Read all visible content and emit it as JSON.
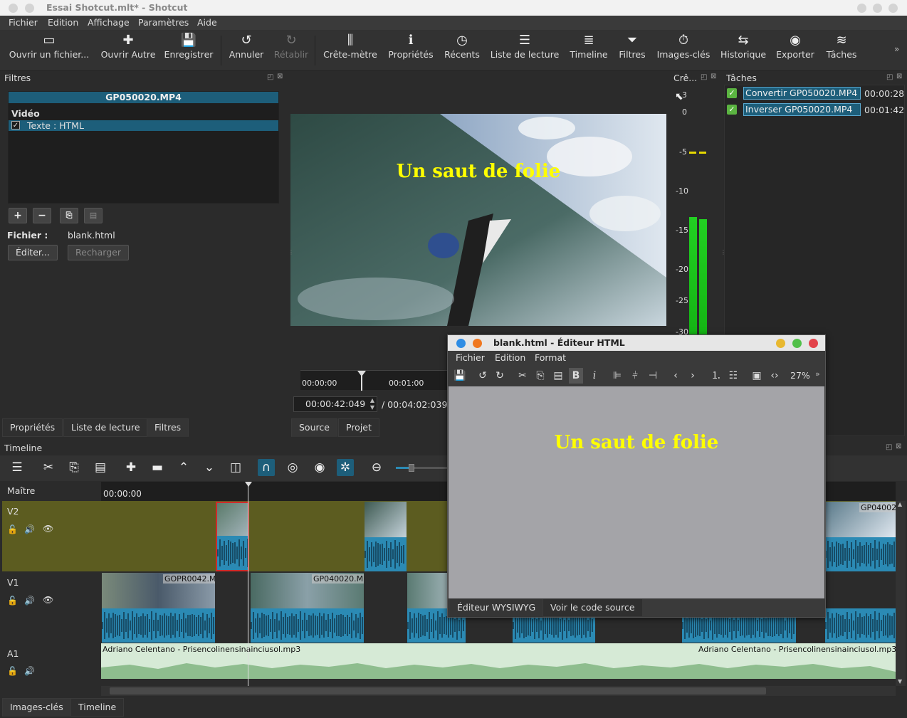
{
  "window": {
    "title": "Essai Shotcut.mlt* - Shotcut"
  },
  "menu": [
    "Fichier",
    "Edition",
    "Affichage",
    "Paramètres",
    "Aide"
  ],
  "toolbar": [
    {
      "label": "Ouvrir un fichier...",
      "icon": "open-folder-icon"
    },
    {
      "label": "Ouvrir Autre",
      "icon": "open-other-icon"
    },
    {
      "label": "Enregistrer",
      "icon": "save-icon"
    },
    {
      "label": "Annuler",
      "icon": "undo-icon"
    },
    {
      "label": "Rétablir",
      "icon": "redo-icon"
    },
    {
      "label": "Crête-mètre",
      "icon": "peak-meter-icon"
    },
    {
      "label": "Propriétés",
      "icon": "info-icon"
    },
    {
      "label": "Récents",
      "icon": "clock-icon"
    },
    {
      "label": "Liste de lecture",
      "icon": "list-icon"
    },
    {
      "label": "Timeline",
      "icon": "timeline-icon"
    },
    {
      "label": "Filtres",
      "icon": "filter-icon"
    },
    {
      "label": "Images-clés",
      "icon": "stopwatch-icon"
    },
    {
      "label": "Historique",
      "icon": "history-icon"
    },
    {
      "label": "Exporter",
      "icon": "disc-icon"
    },
    {
      "label": "Tâches",
      "icon": "stack-icon"
    }
  ],
  "filters": {
    "title": "Filtres",
    "clip": "GP050020.MP4",
    "section": "Vidéo",
    "item": "Texte : HTML",
    "file_label": "Fichier :",
    "file_value": "blank.html",
    "edit": "Éditer...",
    "reload": "Recharger"
  },
  "bottom_tabs_left": [
    "Propriétés",
    "Liste de lecture",
    "Filtres"
  ],
  "player": {
    "overlay_text": "Un saut de folie",
    "ruler": [
      "00:00:00",
      "00:01:00"
    ],
    "position": "00:00:42:049",
    "duration": "/ 00:04:02:039",
    "tabs": [
      "Source",
      "Projet"
    ]
  },
  "meter": {
    "title": "Crê...",
    "scale": [
      "3",
      "0",
      "-5",
      "-10",
      "-15",
      "-20",
      "-25",
      "-30"
    ]
  },
  "tasks": {
    "title": "Tâches",
    "items": [
      {
        "name": "Convertir GP050020.MP4",
        "time": "00:00:28"
      },
      {
        "name": "Inverser GP050020.MP4",
        "time": "00:01:42"
      }
    ]
  },
  "timeline": {
    "title": "Timeline",
    "master": "Maître",
    "ruler_start": "00:00:00",
    "tracks": [
      "V2",
      "V1",
      "A1"
    ],
    "clip_labels": [
      "GOPR0042.M",
      "GP040020.M",
      "GP04002"
    ],
    "audio_label": "Adriano Celentano - Prisencolinensinainciusol.mp3"
  },
  "bottom_tabs": [
    "Images-clés",
    "Timeline"
  ],
  "html_editor": {
    "title": "blank.html - Éditeur HTML",
    "menu": [
      "Fichier",
      "Edition",
      "Format"
    ],
    "zoom": "27%",
    "content": "Un saut de folie",
    "tabs": [
      "Éditeur WYSIWYG",
      "Voir le code source"
    ]
  },
  "colors": {
    "accent": "#1d5e7a",
    "overlay_text": "#ffff00",
    "v2_track": "#5c5c20",
    "audio_wave": "#2b8ab4"
  }
}
